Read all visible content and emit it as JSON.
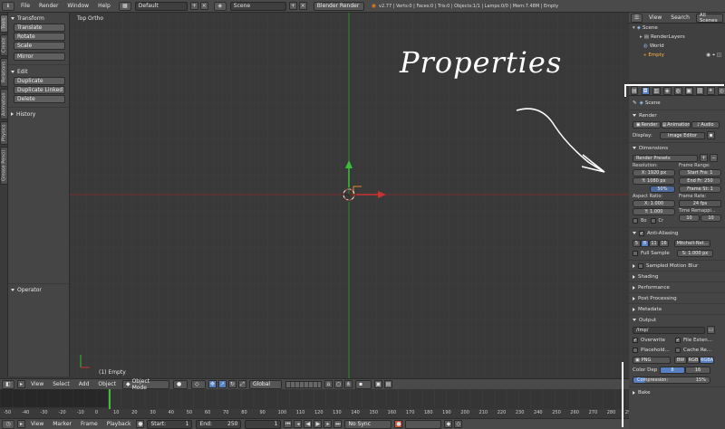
{
  "topbar": {
    "menus": [
      "File",
      "Render",
      "Window",
      "Help"
    ],
    "screen_layout": "Default",
    "scene": "Scene",
    "render_engine": "Blender Render",
    "stats": "v2.77 | Verts:0 | Faces:0 | Tris:0 | Objects:1/1 | Lamps:0/0 | Mem:7.48M | Empty"
  },
  "toolshelf": {
    "tabs": [
      "Tools",
      "Create",
      "Relations",
      "Animation",
      "Physics",
      "Grease Pencil"
    ],
    "transform_header": "Transform",
    "transform_buttons": [
      "Translate",
      "Rotate",
      "Scale"
    ],
    "mirror_button": "Mirror",
    "edit_header": "Edit",
    "edit_buttons": [
      "Duplicate",
      "Duplicate Linked",
      "Delete"
    ],
    "history_header": "History",
    "operator_header": "Operator"
  },
  "viewport": {
    "view_name": "Top Ortho",
    "object_label": "(1) Empty",
    "annotation": "Properties"
  },
  "view3d_header": {
    "menus": [
      "View",
      "Select",
      "Add",
      "Object"
    ],
    "mode": "Object Mode",
    "orientation": "Global"
  },
  "timeline": {
    "ruler": [
      "-50",
      "-40",
      "-30",
      "-20",
      "-10",
      "0",
      "10",
      "20",
      "30",
      "40",
      "50",
      "60",
      "70",
      "80",
      "90",
      "100",
      "110",
      "120",
      "130",
      "140",
      "150",
      "160",
      "170",
      "180",
      "190",
      "200",
      "210",
      "220",
      "230",
      "240",
      "250",
      "260",
      "270",
      "280",
      "290"
    ],
    "menus": [
      "View",
      "Marker",
      "Frame",
      "Playback"
    ],
    "start_label": "Start:",
    "start_value": "1",
    "end_label": "End:",
    "end_value": "250",
    "current_frame": "1",
    "sync": "No Sync"
  },
  "outliner": {
    "menus": [
      "View",
      "Search"
    ],
    "filter": "All Scenes",
    "items": [
      "Scene",
      "RenderLayers",
      "World",
      "Empty"
    ]
  },
  "properties": {
    "context": "Scene",
    "render_header": "Render",
    "render_buttons": [
      "Render",
      "Animation",
      "Audio"
    ],
    "display_label": "Display:",
    "display_value": "Image Editor",
    "dimensions_header": "Dimensions",
    "presets": "Render Presets",
    "resolution_label": "Resolution:",
    "res_x": "X: 1920 px",
    "res_y": "Y: 1080 px",
    "res_pct": "50%",
    "frame_range_label": "Frame Range:",
    "start_fra": "Start Fra: 1",
    "end_fr": "End Fr: 250",
    "frame_st": "Frame St: 1",
    "aspect_label": "Aspect Ratio:",
    "asp_x": "X: 1.000",
    "asp_y": "Y: 1.000",
    "frame_rate_label": "Frame Rate:",
    "fps": "24 fps",
    "time_remap_label": "Time Remappi...",
    "remap_old": "10",
    "remap_new": "10",
    "bo_label": "Bo",
    "cr_label": "Cr",
    "aa_header": "Anti-Aliasing",
    "aa_samples": [
      "5",
      "8",
      "11",
      "16"
    ],
    "aa_filter": "Mitchell-Net...",
    "full_sample": "Full Sample",
    "filter_size": "S: 1.000 px",
    "collapsed": [
      "Sampled Motion Blur",
      "Shading",
      "Performance",
      "Post Processing",
      "Metadata"
    ],
    "output_header": "Output",
    "output_path": "/tmp/",
    "overwrite": "Overwrite",
    "file_ext": "File Exten...",
    "placeholders": "Placehold...",
    "cache_result": "Cache Re...",
    "format": "PNG",
    "color_modes": [
      "BW",
      "RGB",
      "RGBA"
    ],
    "color_depth_label": "Color Dep",
    "color_depths": [
      "8",
      "16"
    ],
    "compression": "Compression:",
    "compression_value": "15%",
    "bake_header": "Bake"
  },
  "colors": {
    "selected_blue": "#5680c2",
    "x_axis_red": "#c83232",
    "y_axis_green": "#3ca03c",
    "playhead_green": "#45b83a"
  }
}
